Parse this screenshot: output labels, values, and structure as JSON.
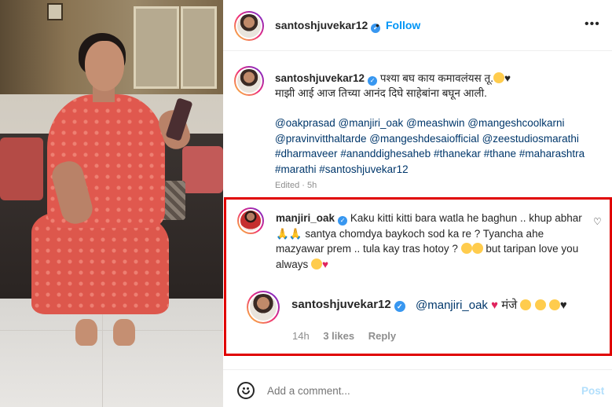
{
  "header": {
    "username": "santoshjuvekar12",
    "separator": "•",
    "follow_label": "Follow",
    "more_label": "•••"
  },
  "caption": {
    "username": "santoshjuvekar12",
    "line1": "पश्या बघ काय कमावलंयस तू.",
    "line2": "माझी आई आज तिच्या आनंद दिघे साहेबांना बघून आली.",
    "tags": [
      "@oakprasad",
      "@manjiri_oak",
      "@meashwin",
      "@mangeshcoolkarni",
      "@pravinvitthaltarde",
      "@mangeshdesaiofficial",
      "@zeestudiosmarathi",
      "#dharmaveer",
      "#ananddighesaheb",
      "#thanekar",
      "#thane",
      "#maharashtra",
      "#marathi",
      "#santoshjuvekar12"
    ],
    "edited_label": "Edited",
    "edited_time": "5h"
  },
  "comment": {
    "username": "manjiri_oak",
    "text1": "Kaku kitti kitti bara watla he baghun .. khup abhar",
    "text2": "santya chomdya baykoch sod ka re ? Tyancha ahe mazyawar prem .. tula kay tras hotoy ?",
    "text3": "but taripan love you always"
  },
  "reply": {
    "username": "santoshjuvekar12",
    "mention": "@manjiri_oak",
    "text": "मंजे",
    "time": "14h",
    "likes": "3 likes",
    "reply_label": "Reply"
  },
  "add_comment": {
    "placeholder": "Add a comment...",
    "post_label": "Post"
  },
  "colors": {
    "accent": "#0095f6",
    "link": "#00376b",
    "highlight_border": "#e00000",
    "muted": "#8e8e8e"
  }
}
